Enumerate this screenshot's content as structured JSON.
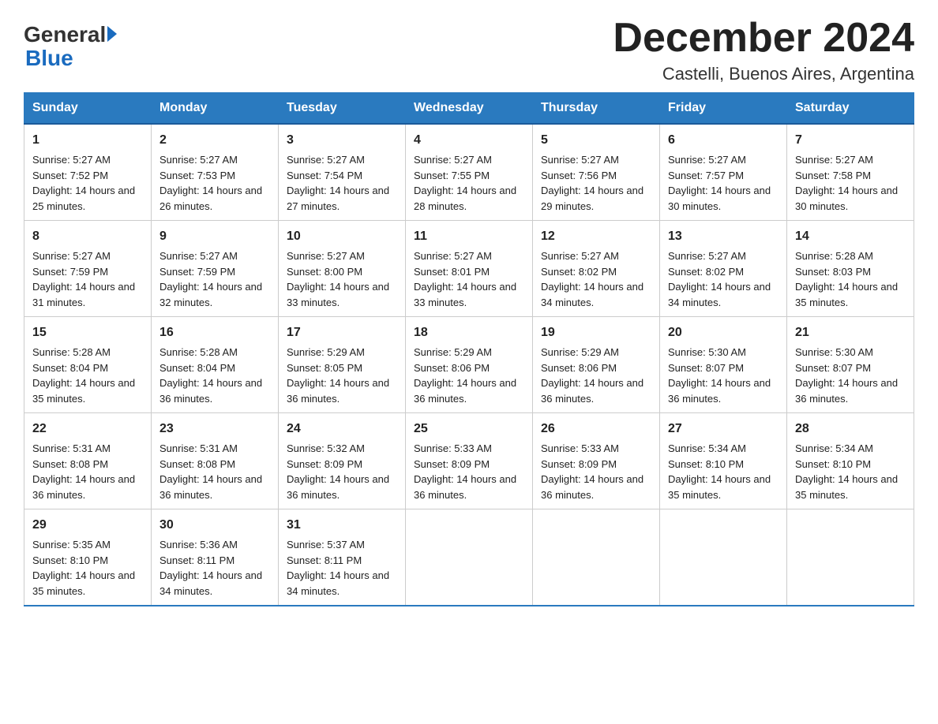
{
  "header": {
    "month_title": "December 2024",
    "subtitle": "Castelli, Buenos Aires, Argentina"
  },
  "logo": {
    "general": "General",
    "arrow": "▶",
    "blue": "Blue"
  },
  "days_of_week": [
    "Sunday",
    "Monday",
    "Tuesday",
    "Wednesday",
    "Thursday",
    "Friday",
    "Saturday"
  ],
  "weeks": [
    [
      {
        "day": "1",
        "sunrise": "5:27 AM",
        "sunset": "7:52 PM",
        "daylight": "14 hours and 25 minutes."
      },
      {
        "day": "2",
        "sunrise": "5:27 AM",
        "sunset": "7:53 PM",
        "daylight": "14 hours and 26 minutes."
      },
      {
        "day": "3",
        "sunrise": "5:27 AM",
        "sunset": "7:54 PM",
        "daylight": "14 hours and 27 minutes."
      },
      {
        "day": "4",
        "sunrise": "5:27 AM",
        "sunset": "7:55 PM",
        "daylight": "14 hours and 28 minutes."
      },
      {
        "day": "5",
        "sunrise": "5:27 AM",
        "sunset": "7:56 PM",
        "daylight": "14 hours and 29 minutes."
      },
      {
        "day": "6",
        "sunrise": "5:27 AM",
        "sunset": "7:57 PM",
        "daylight": "14 hours and 30 minutes."
      },
      {
        "day": "7",
        "sunrise": "5:27 AM",
        "sunset": "7:58 PM",
        "daylight": "14 hours and 30 minutes."
      }
    ],
    [
      {
        "day": "8",
        "sunrise": "5:27 AM",
        "sunset": "7:59 PM",
        "daylight": "14 hours and 31 minutes."
      },
      {
        "day": "9",
        "sunrise": "5:27 AM",
        "sunset": "7:59 PM",
        "daylight": "14 hours and 32 minutes."
      },
      {
        "day": "10",
        "sunrise": "5:27 AM",
        "sunset": "8:00 PM",
        "daylight": "14 hours and 33 minutes."
      },
      {
        "day": "11",
        "sunrise": "5:27 AM",
        "sunset": "8:01 PM",
        "daylight": "14 hours and 33 minutes."
      },
      {
        "day": "12",
        "sunrise": "5:27 AM",
        "sunset": "8:02 PM",
        "daylight": "14 hours and 34 minutes."
      },
      {
        "day": "13",
        "sunrise": "5:27 AM",
        "sunset": "8:02 PM",
        "daylight": "14 hours and 34 minutes."
      },
      {
        "day": "14",
        "sunrise": "5:28 AM",
        "sunset": "8:03 PM",
        "daylight": "14 hours and 35 minutes."
      }
    ],
    [
      {
        "day": "15",
        "sunrise": "5:28 AM",
        "sunset": "8:04 PM",
        "daylight": "14 hours and 35 minutes."
      },
      {
        "day": "16",
        "sunrise": "5:28 AM",
        "sunset": "8:04 PM",
        "daylight": "14 hours and 36 minutes."
      },
      {
        "day": "17",
        "sunrise": "5:29 AM",
        "sunset": "8:05 PM",
        "daylight": "14 hours and 36 minutes."
      },
      {
        "day": "18",
        "sunrise": "5:29 AM",
        "sunset": "8:06 PM",
        "daylight": "14 hours and 36 minutes."
      },
      {
        "day": "19",
        "sunrise": "5:29 AM",
        "sunset": "8:06 PM",
        "daylight": "14 hours and 36 minutes."
      },
      {
        "day": "20",
        "sunrise": "5:30 AM",
        "sunset": "8:07 PM",
        "daylight": "14 hours and 36 minutes."
      },
      {
        "day": "21",
        "sunrise": "5:30 AM",
        "sunset": "8:07 PM",
        "daylight": "14 hours and 36 minutes."
      }
    ],
    [
      {
        "day": "22",
        "sunrise": "5:31 AM",
        "sunset": "8:08 PM",
        "daylight": "14 hours and 36 minutes."
      },
      {
        "day": "23",
        "sunrise": "5:31 AM",
        "sunset": "8:08 PM",
        "daylight": "14 hours and 36 minutes."
      },
      {
        "day": "24",
        "sunrise": "5:32 AM",
        "sunset": "8:09 PM",
        "daylight": "14 hours and 36 minutes."
      },
      {
        "day": "25",
        "sunrise": "5:33 AM",
        "sunset": "8:09 PM",
        "daylight": "14 hours and 36 minutes."
      },
      {
        "day": "26",
        "sunrise": "5:33 AM",
        "sunset": "8:09 PM",
        "daylight": "14 hours and 36 minutes."
      },
      {
        "day": "27",
        "sunrise": "5:34 AM",
        "sunset": "8:10 PM",
        "daylight": "14 hours and 35 minutes."
      },
      {
        "day": "28",
        "sunrise": "5:34 AM",
        "sunset": "8:10 PM",
        "daylight": "14 hours and 35 minutes."
      }
    ],
    [
      {
        "day": "29",
        "sunrise": "5:35 AM",
        "sunset": "8:10 PM",
        "daylight": "14 hours and 35 minutes."
      },
      {
        "day": "30",
        "sunrise": "5:36 AM",
        "sunset": "8:11 PM",
        "daylight": "14 hours and 34 minutes."
      },
      {
        "day": "31",
        "sunrise": "5:37 AM",
        "sunset": "8:11 PM",
        "daylight": "14 hours and 34 minutes."
      },
      null,
      null,
      null,
      null
    ]
  ],
  "labels": {
    "sunrise": "Sunrise:",
    "sunset": "Sunset:",
    "daylight": "Daylight:"
  }
}
